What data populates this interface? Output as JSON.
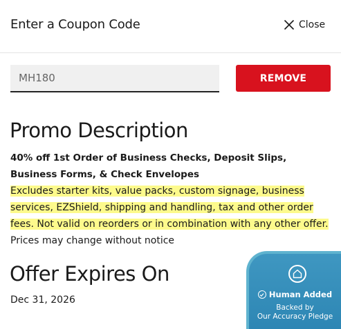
{
  "header": {
    "title": "Enter a Coupon Code",
    "close_label": "Close"
  },
  "coupon": {
    "value": "MH180",
    "remove_label": "REMOVE"
  },
  "promo": {
    "heading": "Promo Description",
    "offer": "40% off 1st Order of Business Checks, Deposit Slips, Business Forms, & Check Envelopes",
    "exclusions": "Excludes starter kits, value packs, custom signage, business services, EZShield, shipping and handling, tax and other order fees. Not valid on reorders or in combination with any other offer.",
    "note": "Prices may change without notice"
  },
  "expires": {
    "heading": "Offer Expires On",
    "date": "Dec 31, 2026"
  },
  "badge": {
    "title": "Human Added",
    "line1": "Backed by",
    "line2": "Our Accuracy Pledge"
  },
  "colors": {
    "accent": "#d8121e",
    "highlight": "#fdfa8c",
    "badge": "#3f97c1"
  }
}
